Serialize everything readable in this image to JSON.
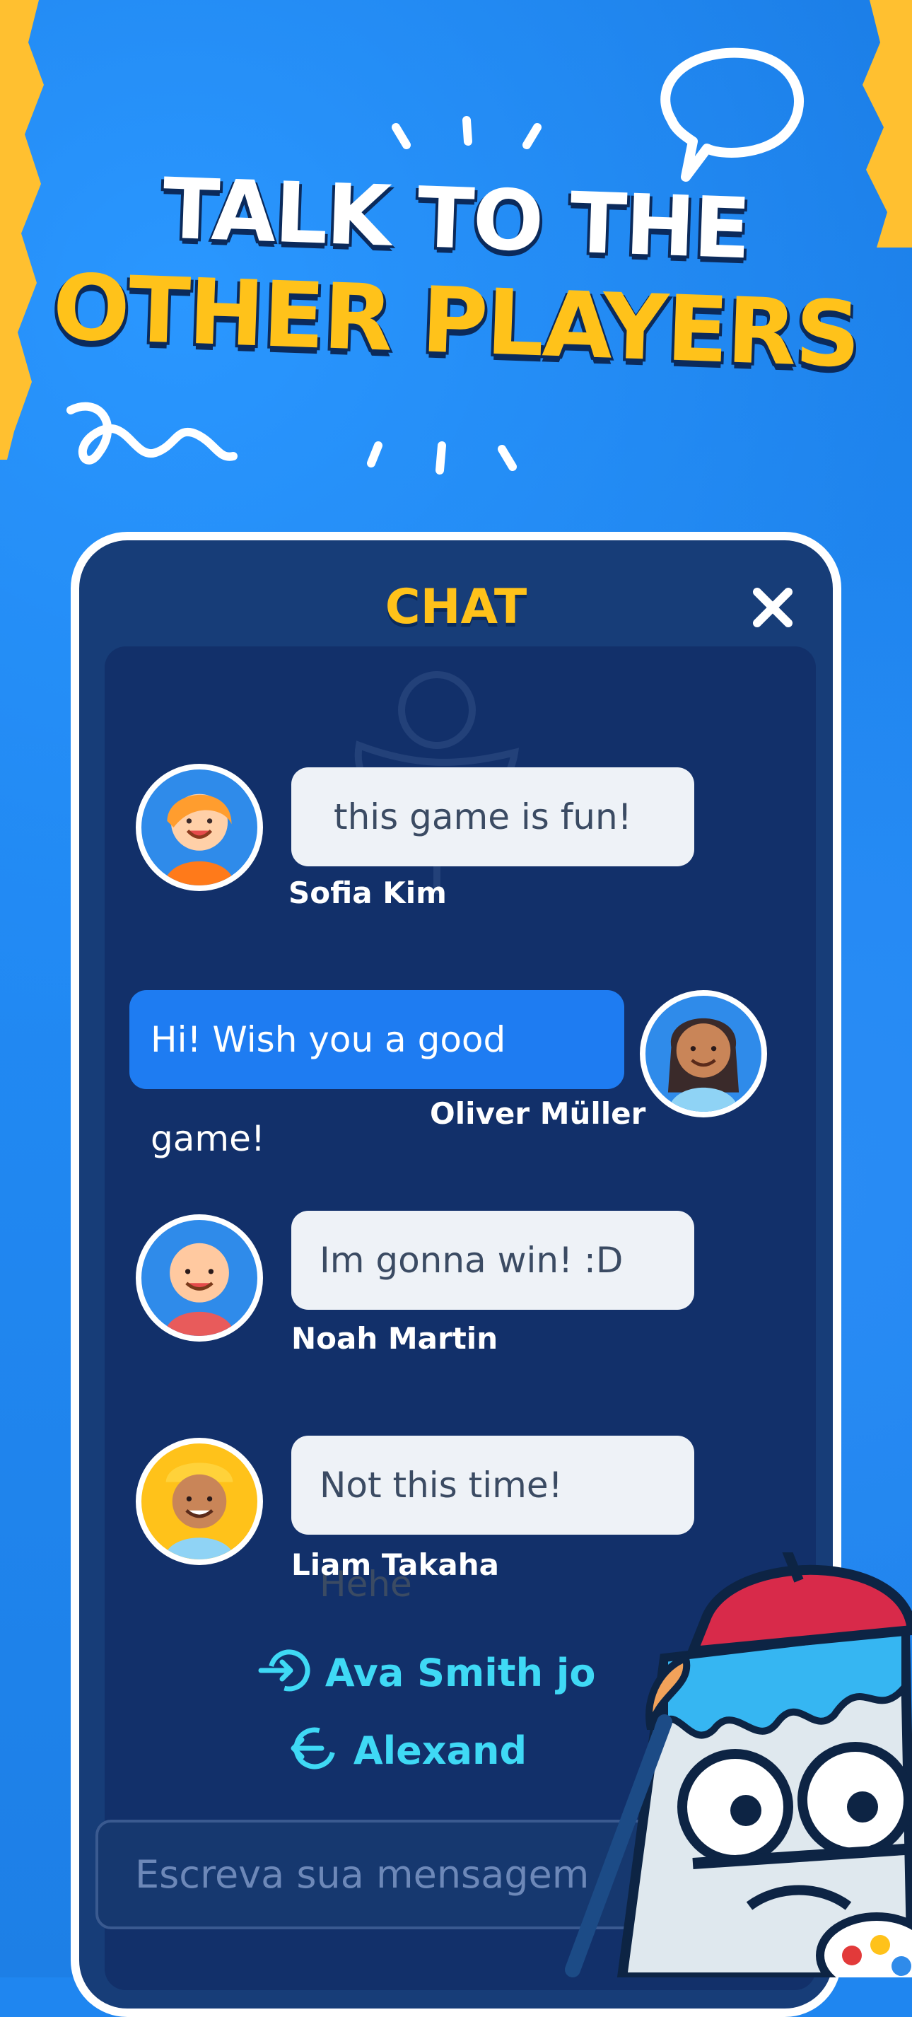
{
  "headline": {
    "line1": "TALK TO THE",
    "line2": "OTHER PLAYERS"
  },
  "chat": {
    "title": "CHAT",
    "close_icon": "close-icon",
    "messages": [
      {
        "name": "Sofia Kim",
        "text": "this game is fun!",
        "side": "left"
      },
      {
        "name": "Oliver Müller",
        "text": "Hi! Wish you a good game!",
        "side": "right"
      },
      {
        "name": "Noah Martin",
        "text": "Im gonna win! :D",
        "side": "left"
      },
      {
        "name": "Liam Takaha",
        "text": "Not this time! Hehe",
        "side": "left"
      }
    ],
    "system": [
      {
        "icon": "login-icon",
        "name": "Ava Smith",
        "suffix": " jo"
      },
      {
        "icon": "logout-icon",
        "name": "Alexand",
        "suffix": ""
      }
    ],
    "input": {
      "placeholder": "Escreva sua mensagem"
    }
  },
  "colors": {
    "accent_yellow": "#ffc21a",
    "background_blue": "#1f86f0",
    "panel_navy": "#12306a",
    "system_cyan": "#3fd9f5",
    "own_bubble": "#1e7cf2"
  }
}
